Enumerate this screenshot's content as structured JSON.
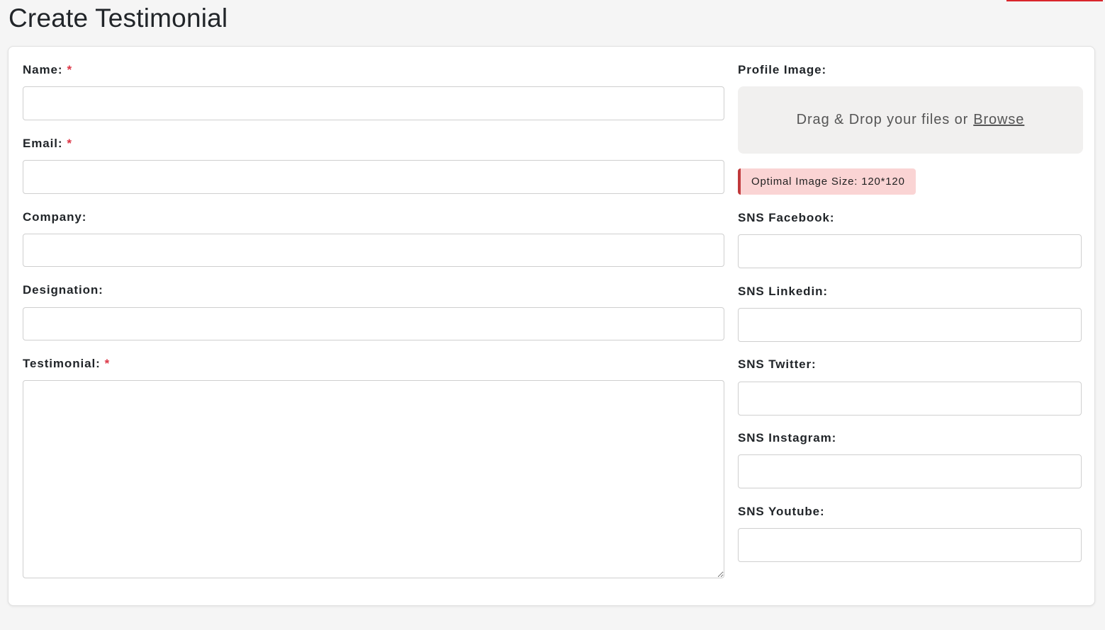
{
  "page": {
    "title": "Create Testimonial"
  },
  "form": {
    "required_marker": "*",
    "name": {
      "label": "Name:",
      "value": "",
      "placeholder": ""
    },
    "email": {
      "label": "Email:",
      "value": "",
      "placeholder": ""
    },
    "company": {
      "label": "Company:",
      "value": "",
      "placeholder": ""
    },
    "designation": {
      "label": "Designation:",
      "value": "",
      "placeholder": ""
    },
    "testimonial": {
      "label": "Testimonial:",
      "value": "",
      "placeholder": ""
    },
    "profile_image": {
      "label": "Profile Image:",
      "drop_text": "Drag & Drop your files or",
      "browse_label": "Browse",
      "hint": "Optimal Image Size: 120*120"
    },
    "sns_facebook": {
      "label": "SNS Facebook:",
      "value": ""
    },
    "sns_linkedin": {
      "label": "SNS Linkedin:",
      "value": ""
    },
    "sns_twitter": {
      "label": "SNS Twitter:",
      "value": ""
    },
    "sns_instagram": {
      "label": "SNS Instagram:",
      "value": ""
    },
    "sns_youtube": {
      "label": "SNS Youtube:",
      "value": ""
    }
  },
  "colors": {
    "accent": "#d9262c",
    "required": "#dc3545",
    "hint_bg": "#fad4d4",
    "hint_border": "#c0393b"
  }
}
